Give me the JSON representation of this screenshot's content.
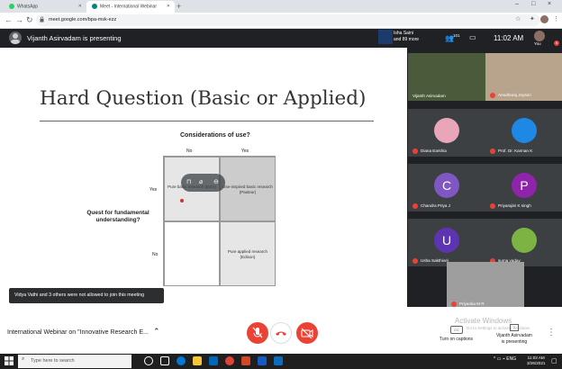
{
  "browser": {
    "tabs": [
      {
        "title": "WhatsApp",
        "color": "#25d366"
      },
      {
        "title": "Meet - International Webinar",
        "color": "#00897b"
      }
    ],
    "new_tab_glyph": "+",
    "url": "meet.google.com/bpa-msk-ezz",
    "window_controls": [
      "–",
      "□",
      "×"
    ]
  },
  "meet": {
    "presenting_banner": "Vijanth Asirvadam is presenting",
    "thumbnail_names": [
      "Isha Saini",
      "and 89 more"
    ],
    "people_count": "101",
    "clock": "11:02 AM",
    "you_label": "You",
    "alert_count": "5",
    "toast": "Vidya Vathi and 3 others were not allowed to join this meeting",
    "meeting_title": "International Webinar on \"Innovative Research E...",
    "captions_label": "Turn on captions",
    "present_label_1": "Vijanth Asirvadam",
    "present_label_2": "is presenting",
    "activate_windows": "Activate Windows",
    "activate_sub": "Go to Settings to activate Windows."
  },
  "slide": {
    "title": "Hard Question (Basic or Applied)",
    "considerations": "Considerations of use?",
    "col_no": "No",
    "col_yes": "Yes",
    "row_yes": "Yes",
    "row_no": "No",
    "quest_label": "Quest for fundamental understanding?",
    "cell_tl": "Pure basic research (Bohr)",
    "cell_tr": "Use-inspired basic research (Pasteur)",
    "cell_br": "Pure applied research (Edison)"
  },
  "participants": [
    {
      "name": "Vijanth Asirvadam",
      "muted": false,
      "kind": "video",
      "color": "#4a5a3a"
    },
    {
      "name": "Amutharaj Joyson",
      "muted": true,
      "kind": "video",
      "color": "#b8a48c"
    },
    {
      "name": "Diana Earshia",
      "muted": true,
      "kind": "photo",
      "color": "#e9a5b9"
    },
    {
      "name": "Prof. Dr. Kannan K",
      "muted": true,
      "kind": "photo",
      "color": "#1e88e5"
    },
    {
      "name": "Chandra Priya J",
      "muted": true,
      "kind": "letter",
      "letter": "C",
      "color": "#7e57c2"
    },
    {
      "name": "Priyarajini K singh",
      "muted": true,
      "kind": "letter",
      "letter": "P",
      "color": "#8e24aa"
    },
    {
      "name": "Usha Sakthivel",
      "muted": true,
      "kind": "letter",
      "letter": "U",
      "color": "#5e35b1"
    },
    {
      "name": "suma yadav",
      "muted": true,
      "kind": "photo",
      "color": "#7cb342"
    },
    {
      "name": "Priyanka M R",
      "muted": true,
      "kind": "video",
      "color": "#9e9e9e"
    }
  ],
  "taskbar": {
    "search_placeholder": "Type here to search",
    "tray": "^ ▭ ⌁ ENG",
    "time": "11:03 AM",
    "date": "3/26/2021"
  }
}
